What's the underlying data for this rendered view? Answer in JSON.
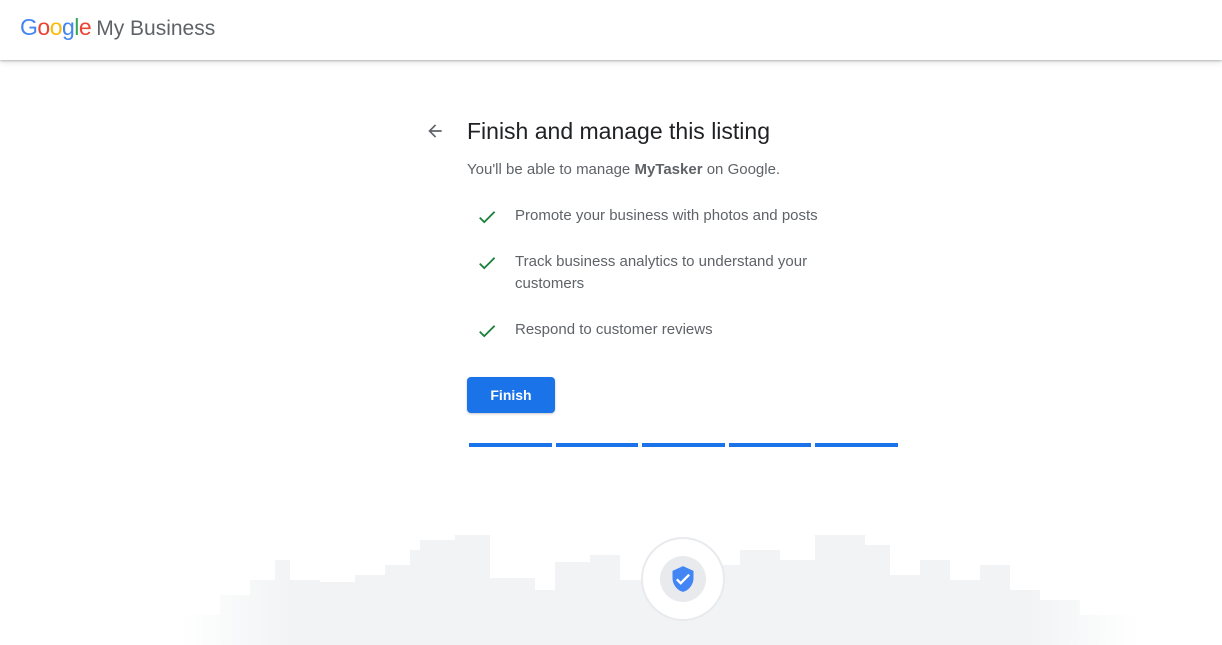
{
  "header": {
    "logo_letters": [
      "G",
      "o",
      "o",
      "g",
      "l",
      "e"
    ],
    "logo_colors": [
      "#4285F4",
      "#EA4335",
      "#FBBC05",
      "#4285F4",
      "#34A853",
      "#EA4335"
    ],
    "product_name": "My Business"
  },
  "page": {
    "back_icon": "arrow-left-icon",
    "title": "Finish and manage this listing",
    "subtitle_prefix": "You'll be able to manage ",
    "business_name": "MyTasker",
    "subtitle_suffix": " on Google.",
    "features": [
      "Promote your business with photos and posts",
      "Track business analytics to understand your customers",
      "Respond to customer reviews"
    ],
    "check_color": "#188038",
    "finish_label": "Finish",
    "accent_color": "#1a73e8",
    "progress": {
      "total_steps": 5,
      "completed_steps": 5
    }
  },
  "illustration": {
    "shield_icon": "verified-shield-icon",
    "shield_color": "#4285F4"
  }
}
